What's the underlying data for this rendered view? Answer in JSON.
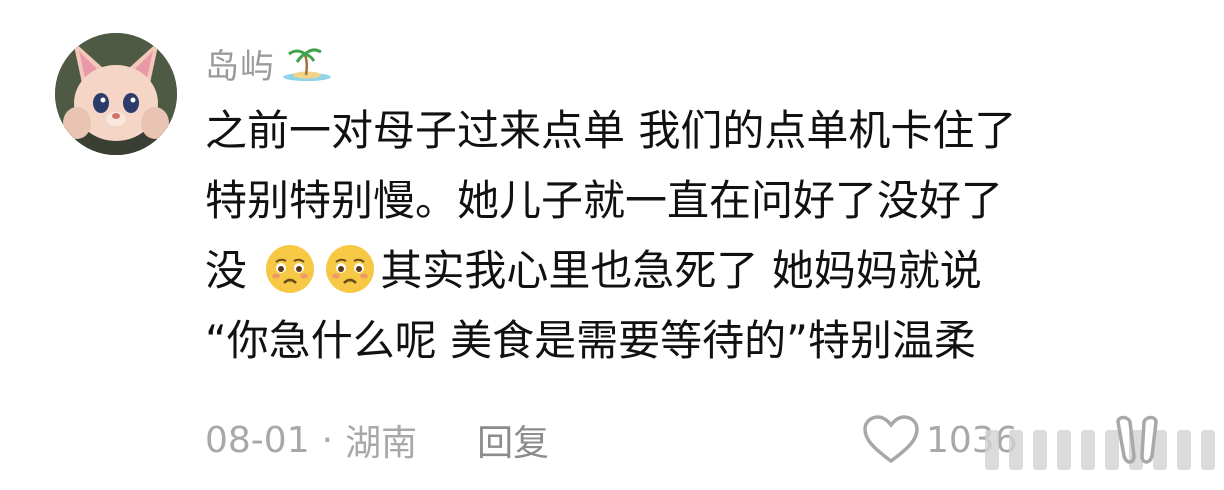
{
  "comment": {
    "username": "岛屿",
    "username_icon": "palm-island-emoji",
    "lines": [
      "之前一对母子过来点单 我们的点单机卡住了",
      "特别特别慢。她儿子就一直在问好了没好了",
      "其实我心里也急死了 她妈妈就说",
      "“你急什么呢 美食是需要等待的”特别温柔"
    ],
    "line3_prefix": "没",
    "inline_emoji": "pleading-face-emoji",
    "date": "08-01",
    "separator": "·",
    "location": "湖南",
    "reply_label": "回复",
    "like_count": "1036"
  }
}
